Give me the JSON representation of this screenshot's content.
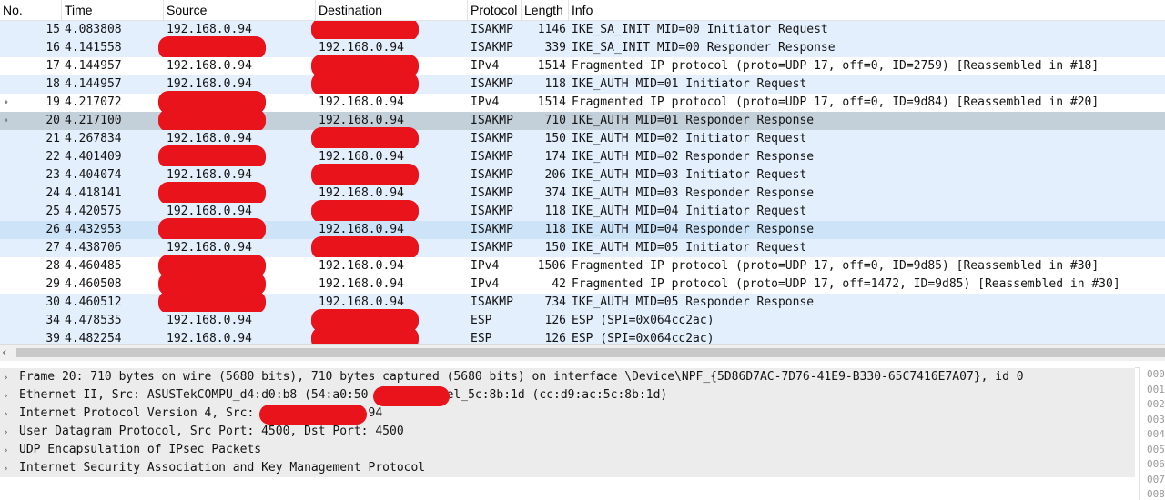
{
  "colors": {
    "isakmp_bg": "#e4effd",
    "ipv4_bg": "#ffffff",
    "selected_bg": "#c3cfd9",
    "hover_bg": "#cde3f8",
    "redaction": "#e8131b",
    "detail_selected_bg": "#ececec"
  },
  "columns": {
    "no": "No.",
    "time": "Time",
    "source": "Source",
    "destination": "Destination",
    "protocol": "Protocol",
    "length": "Length",
    "info": "Info"
  },
  "packets": [
    {
      "no": "15",
      "time": "4.083808",
      "src": "192.168.0.94",
      "dst": "",
      "proto": "ISAKMP",
      "len": "1146",
      "info": "IKE_SA_INIT MID=00 Initiator Request",
      "kind": "isakmp",
      "mark": ""
    },
    {
      "no": "16",
      "time": "4.141558",
      "src": "",
      "dst": "192.168.0.94",
      "proto": "ISAKMP",
      "len": "339",
      "info": "IKE_SA_INIT MID=00 Responder Response",
      "kind": "isakmp",
      "mark": ""
    },
    {
      "no": "17",
      "time": "4.144957",
      "src": "192.168.0.94",
      "dst": "",
      "proto": "IPv4",
      "len": "1514",
      "info": "Fragmented IP protocol (proto=UDP 17, off=0, ID=2759) [Reassembled in #18]",
      "kind": "ipv4",
      "mark": ""
    },
    {
      "no": "18",
      "time": "4.144957",
      "src": "192.168.0.94",
      "dst": "",
      "proto": "ISAKMP",
      "len": "118",
      "info": "IKE_AUTH MID=01 Initiator Request",
      "kind": "isakmp",
      "mark": ""
    },
    {
      "no": "19",
      "time": "4.217072",
      "src": "",
      "dst": "192.168.0.94",
      "proto": "IPv4",
      "len": "1514",
      "info": "Fragmented IP protocol (proto=UDP 17, off=0, ID=9d84) [Reassembled in #20]",
      "kind": "ipv4",
      "mark": "•"
    },
    {
      "no": "20",
      "time": "4.217100",
      "src": "",
      "dst": "192.168.0.94",
      "proto": "ISAKMP",
      "len": "710",
      "info": "IKE_AUTH MID=01 Responder Response",
      "kind": "selected",
      "mark": "•"
    },
    {
      "no": "21",
      "time": "4.267834",
      "src": "192.168.0.94",
      "dst": "",
      "proto": "ISAKMP",
      "len": "150",
      "info": "IKE_AUTH MID=02 Initiator Request",
      "kind": "isakmp",
      "mark": ""
    },
    {
      "no": "22",
      "time": "4.401409",
      "src": "",
      "dst": "192.168.0.94",
      "proto": "ISAKMP",
      "len": "174",
      "info": "IKE_AUTH MID=02 Responder Response",
      "kind": "isakmp",
      "mark": ""
    },
    {
      "no": "23",
      "time": "4.404074",
      "src": "192.168.0.94",
      "dst": "",
      "proto": "ISAKMP",
      "len": "206",
      "info": "IKE_AUTH MID=03 Initiator Request",
      "kind": "isakmp",
      "mark": ""
    },
    {
      "no": "24",
      "time": "4.418141",
      "src": "",
      "dst": "192.168.0.94",
      "proto": "ISAKMP",
      "len": "374",
      "info": "IKE_AUTH MID=03 Responder Response",
      "kind": "isakmp",
      "mark": ""
    },
    {
      "no": "25",
      "time": "4.420575",
      "src": "192.168.0.94",
      "dst": "",
      "proto": "ISAKMP",
      "len": "118",
      "info": "IKE_AUTH MID=04 Initiator Request",
      "kind": "isakmp",
      "mark": ""
    },
    {
      "no": "26",
      "time": "4.432953",
      "src": "",
      "dst": "192.168.0.94",
      "proto": "ISAKMP",
      "len": "118",
      "info": "IKE_AUTH MID=04 Responder Response",
      "kind": "hover",
      "mark": ""
    },
    {
      "no": "27",
      "time": "4.438706",
      "src": "192.168.0.94",
      "dst": "",
      "proto": "ISAKMP",
      "len": "150",
      "info": "IKE_AUTH MID=05 Initiator Request",
      "kind": "isakmp",
      "mark": ""
    },
    {
      "no": "28",
      "time": "4.460485",
      "src": "",
      "dst": "192.168.0.94",
      "proto": "IPv4",
      "len": "1506",
      "info": "Fragmented IP protocol (proto=UDP 17, off=0, ID=9d85) [Reassembled in #30]",
      "kind": "ipv4",
      "mark": ""
    },
    {
      "no": "29",
      "time": "4.460508",
      "src": "",
      "dst": "192.168.0.94",
      "proto": "IPv4",
      "len": "42",
      "info": "Fragmented IP protocol (proto=UDP 17, off=1472, ID=9d85) [Reassembled in #30]",
      "kind": "ipv4",
      "mark": ""
    },
    {
      "no": "30",
      "time": "4.460512",
      "src": "",
      "dst": "192.168.0.94",
      "proto": "ISAKMP",
      "len": "734",
      "info": "IKE_AUTH MID=05 Responder Response",
      "kind": "isakmp",
      "mark": ""
    },
    {
      "no": "34",
      "time": "4.478535",
      "src": "192.168.0.94",
      "dst": "",
      "proto": "ESP",
      "len": "126",
      "info": "ESP (SPI=0x064cc2ac)",
      "kind": "isakmp",
      "mark": ""
    },
    {
      "no": "39",
      "time": "4.482254",
      "src": "192.168.0.94",
      "dst": "",
      "proto": "ESP",
      "len": "126",
      "info": "ESP (SPI=0x064cc2ac)",
      "kind": "isakmp",
      "mark": ""
    }
  ],
  "details": [
    {
      "text": "Frame 20: 710 bytes on wire (5680 bits), 710 bytes captured (5680 bits) on interface \\Device\\NPF_{5D86D7AC-7D76-41E9-B330-65C7416E7A07}, id 0"
    },
    {
      "text": "Ethernet II, Src: ASUSTekCOMPU_d4:d0:b8 (54:a0:50              , Dst: Intel_5c:8b:1d (cc:d9:ac:5c:8b:1d)"
    },
    {
      "text": "Internet Protocol Version 4, Src:                 Dst: 192.168.0.94"
    },
    {
      "text": "User Datagram Protocol, Src Port: 4500, Dst Port: 4500"
    },
    {
      "text": "UDP Encapsulation of IPsec Packets"
    },
    {
      "text": "Internet Security Association and Key Management Protocol"
    }
  ],
  "hex_offsets": [
    "000",
    "001",
    "002",
    "003",
    "004",
    "005",
    "006",
    "007",
    "008"
  ],
  "icons": {
    "expand": "chevron-right-icon",
    "scroll_left": "scroll-left-arrow-icon"
  }
}
